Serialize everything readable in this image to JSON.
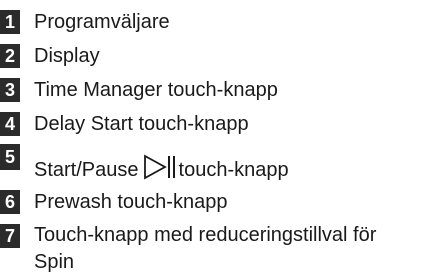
{
  "legend": {
    "items": [
      {
        "number": "1",
        "text": "Programväljare"
      },
      {
        "number": "2",
        "text": "Display"
      },
      {
        "number": "3",
        "text": "Time Manager touch-knapp"
      },
      {
        "number": "4",
        "text": "Delay Start touch-knapp"
      },
      {
        "number": "5",
        "text_before": "Start/Pause",
        "icon": "play-pause-icon",
        "text_after": "touch-knapp"
      },
      {
        "number": "6",
        "text": "Prewash touch-knapp"
      },
      {
        "number": "7",
        "text": "Touch-knapp med reduceringstillval för Spin"
      }
    ]
  }
}
